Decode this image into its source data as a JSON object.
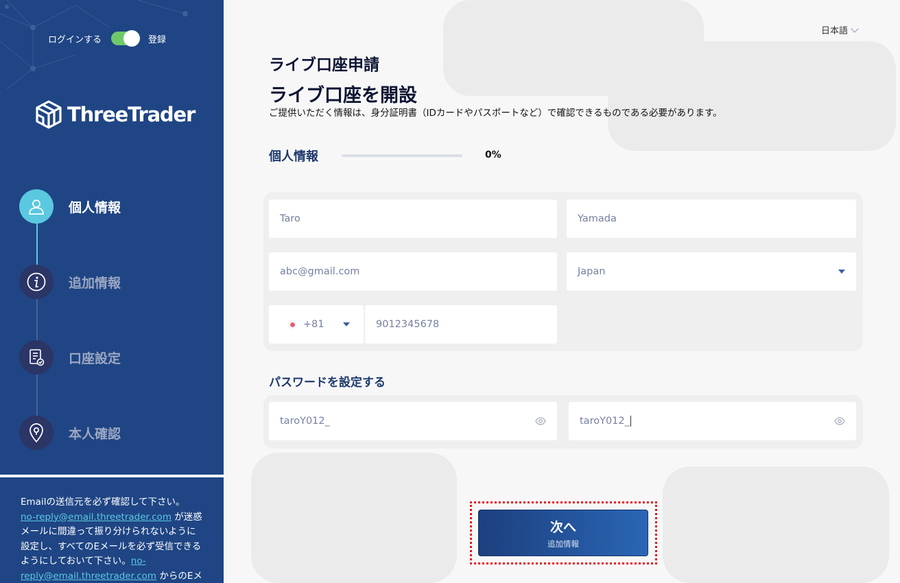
{
  "auth_toggle": {
    "login_label": "ログインする",
    "register_label": "登録",
    "state": "on"
  },
  "brand": {
    "name": "ThreeTrader"
  },
  "steps": [
    {
      "label": "個人情報",
      "icon": "user-icon",
      "active": true
    },
    {
      "label": "追加情報",
      "icon": "info-icon",
      "active": false
    },
    {
      "label": "口座設定",
      "icon": "document-check-icon",
      "active": false
    },
    {
      "label": "本人確認",
      "icon": "location-lock-icon",
      "active": false
    }
  ],
  "side_note": {
    "line1": "Emailの送信元を必ず確認して下さい。",
    "email1": "no-reply@email.threetrader.com",
    "text2": " が迷惑メールに間違って振り分けられないように設定し、すべてのEメールを必ず受信できるようにしておいて下さい。",
    "email2": "no-reply@email.threetrader.com",
    "text3": " からのEメ"
  },
  "header": {
    "language": "日本語"
  },
  "page": {
    "title": "ライブ口座申請",
    "heading": "ライブ口座を開設",
    "subtitle": "ご提供いただく情報は、身分証明書（IDカードやパスポートなど）で確認できるものである必要があります。"
  },
  "section": {
    "title": "個人情報",
    "progress_text": "0%",
    "progress_value": 0
  },
  "form": {
    "first_name": "Taro",
    "last_name": "Yamada",
    "email": "abc@gmail.com",
    "country": "Japan",
    "phone_code": "+81",
    "phone_number": "9012345678"
  },
  "password": {
    "title": "パスワードを設定する",
    "password_value": "taroY012_",
    "confirm_value": "taroY012_"
  },
  "next_button": {
    "label": "次へ",
    "sublabel": "追加情報"
  },
  "colors": {
    "sidebar": "#1f4584",
    "accent": "#5ac8e0",
    "toggle_on": "#6fc96b",
    "highlight": "#e8101a"
  }
}
